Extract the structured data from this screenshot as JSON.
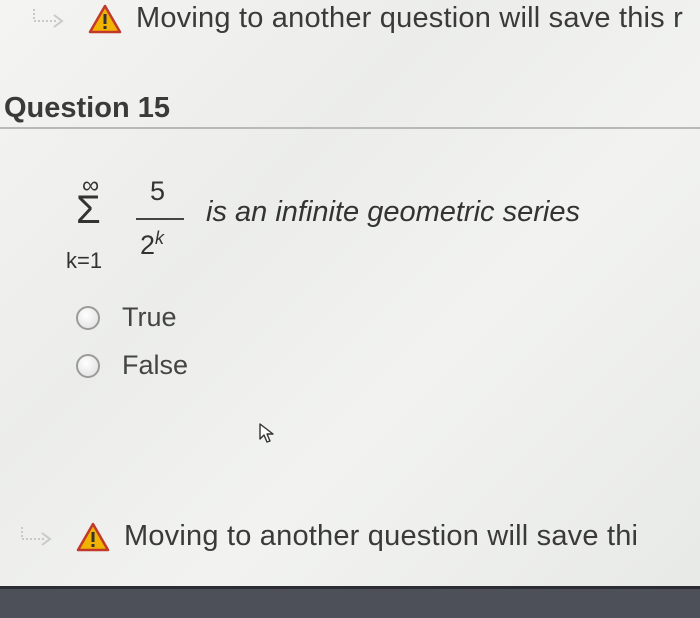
{
  "banner": {
    "top_text": "Moving to another question will save this r",
    "bottom_text": "Moving to another question will save thi"
  },
  "question": {
    "title": "Question 15",
    "sum_upper": "∞",
    "sum_symbol": "Σ",
    "sum_lower": "k=1",
    "numerator": "5",
    "denominator_base": "2",
    "denominator_exp": "k",
    "statement": "is an infinite geometric series"
  },
  "options": [
    {
      "label": "True"
    },
    {
      "label": "False"
    }
  ],
  "colors": {
    "warning": "#f2b300",
    "warning_mark": "#c0392b",
    "background": "#f0f1ef"
  },
  "icons": [
    "arrow-icon",
    "warning-icon",
    "cursor-icon"
  ]
}
